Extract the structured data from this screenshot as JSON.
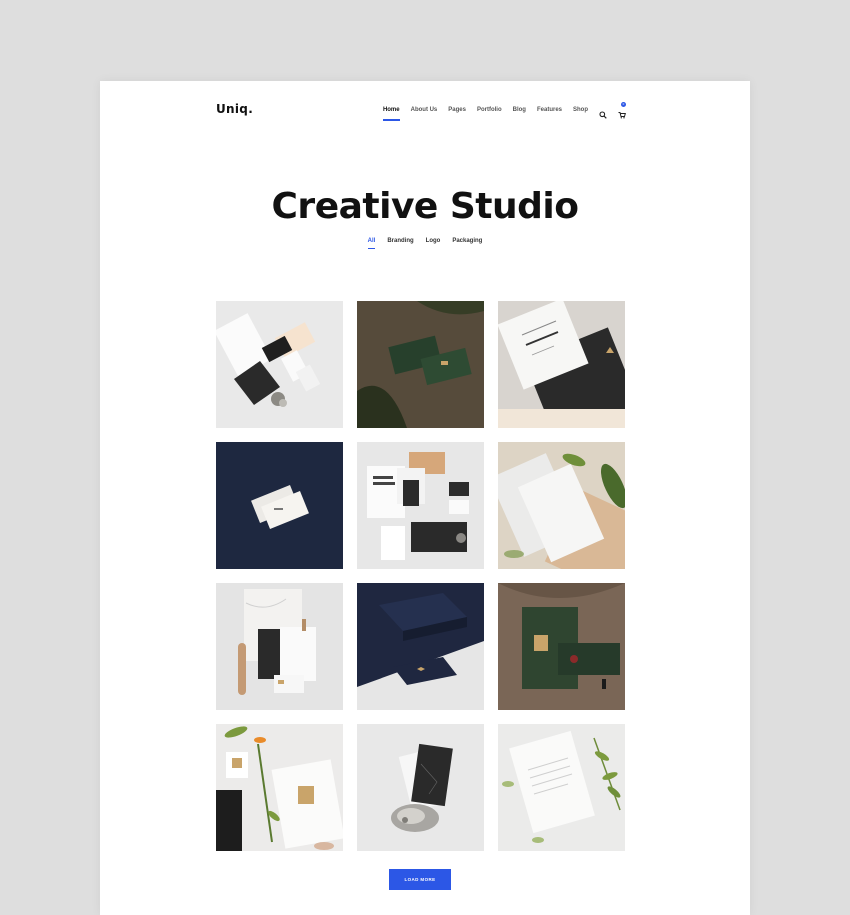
{
  "header": {
    "logo": "Uniq.",
    "nav": [
      "Home",
      "About Us",
      "Pages",
      "Portfolio",
      "Blog",
      "Features",
      "Shop"
    ],
    "icons": {
      "search": "search-icon",
      "cart": "cart-icon"
    },
    "cart_count": "0"
  },
  "hero": {
    "title": "Creative Studio"
  },
  "filters": [
    "All",
    "Branding",
    "Logo",
    "Packaging"
  ],
  "portfolio": {
    "items": [
      {
        "name": "stationery-flatlay-mockup"
      },
      {
        "name": "green-business-cards-mockup"
      },
      {
        "name": "certificate-marble-mockup"
      },
      {
        "name": "navy-business-cards-mockup"
      },
      {
        "name": "good-layers-stationery-mockup"
      },
      {
        "name": "letterhead-leaves-mockup"
      },
      {
        "name": "marble-pen-stationery-mockup"
      },
      {
        "name": "navy-box-card-mockup"
      },
      {
        "name": "dark-green-card-mockup"
      },
      {
        "name": "botanical-flatlay-mockup"
      },
      {
        "name": "marble-cards-geode-mockup"
      },
      {
        "name": "letterhead-branch-mockup"
      }
    ],
    "load_more": "LOAD MORE"
  },
  "colors": {
    "accent": "#2c57e6",
    "page_bg": "#dedede",
    "card_bg": "#ffffff"
  }
}
